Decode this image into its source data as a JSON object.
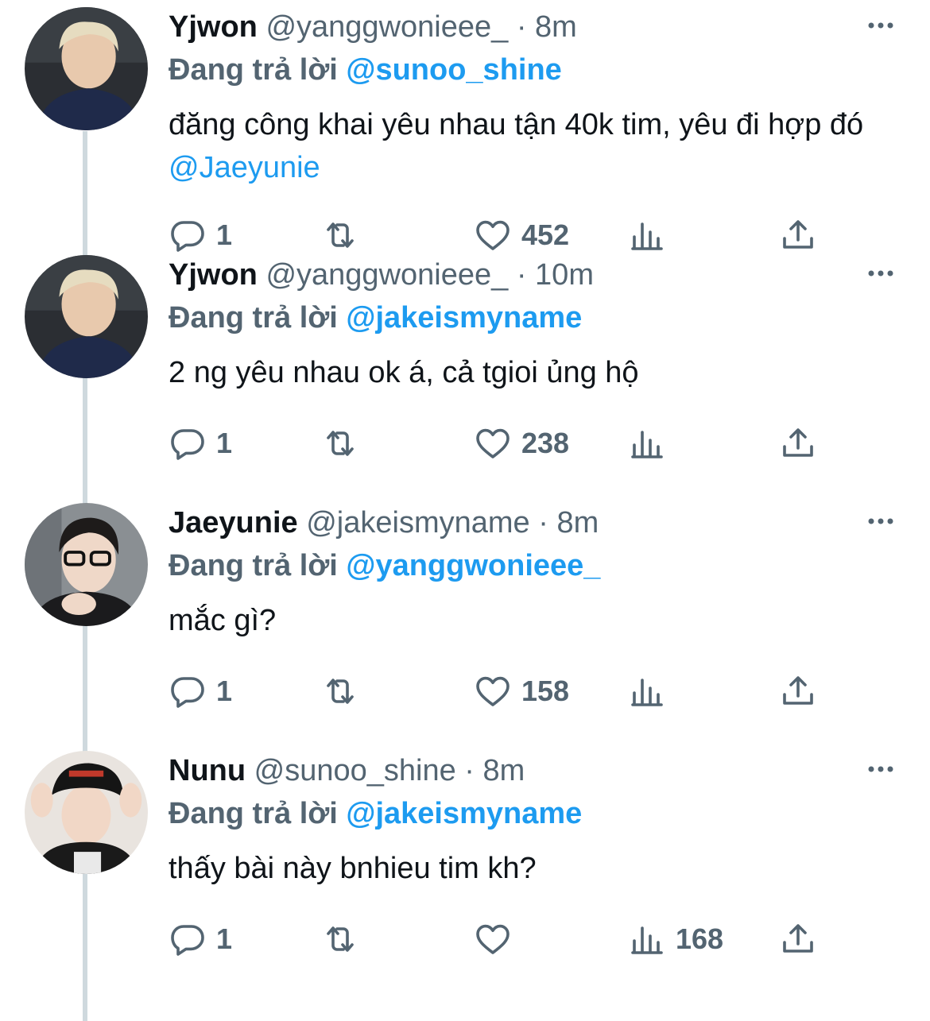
{
  "replying_label": "Đang trả lời",
  "colors": {
    "accent": "#1d9bf0",
    "muted": "#536471",
    "text": "#0f1419",
    "thread_line": "#cfd9de"
  },
  "tweets": [
    {
      "name": "Yjwon",
      "handle": "@yanggwonieee_",
      "separator": "·",
      "time": "10m",
      "replying_to": "@jakeismyname",
      "text": "2 ng yêu nhau ok á, cả tgioi ủng hộ",
      "text_mention": "",
      "replies": "1",
      "retweets": "",
      "likes": "238",
      "views": ""
    },
    {
      "name": "Jaeyunie",
      "handle": "@jakeismyname",
      "separator": "·",
      "time": "8m",
      "replying_to": "@yanggwonieee_",
      "text": "mắc gì?",
      "text_mention": "",
      "replies": "1",
      "retweets": "",
      "likes": "158",
      "views": ""
    },
    {
      "name": "Nunu",
      "handle": "@sunoo_shine",
      "separator": "·",
      "time": "8m",
      "replying_to": "@jakeismyname",
      "text": "thấy bài này bnhieu tim kh?",
      "text_mention": "",
      "replies": "1",
      "retweets": "",
      "likes": "",
      "views": "168"
    },
    {
      "name": "Yjwon",
      "handle": "@yanggwonieee_",
      "separator": "·",
      "time": "8m",
      "replying_to": "@sunoo_shine",
      "text": "đăng công khai yêu nhau tận 40k tim, yêu đi hợp đó ",
      "text_mention": "@Jaeyunie",
      "replies": "1",
      "retweets": "",
      "likes": "452",
      "views": ""
    }
  ],
  "icons": [
    "reply-icon",
    "retweet-icon",
    "like-icon",
    "views-icon",
    "share-icon",
    "more-icon"
  ]
}
